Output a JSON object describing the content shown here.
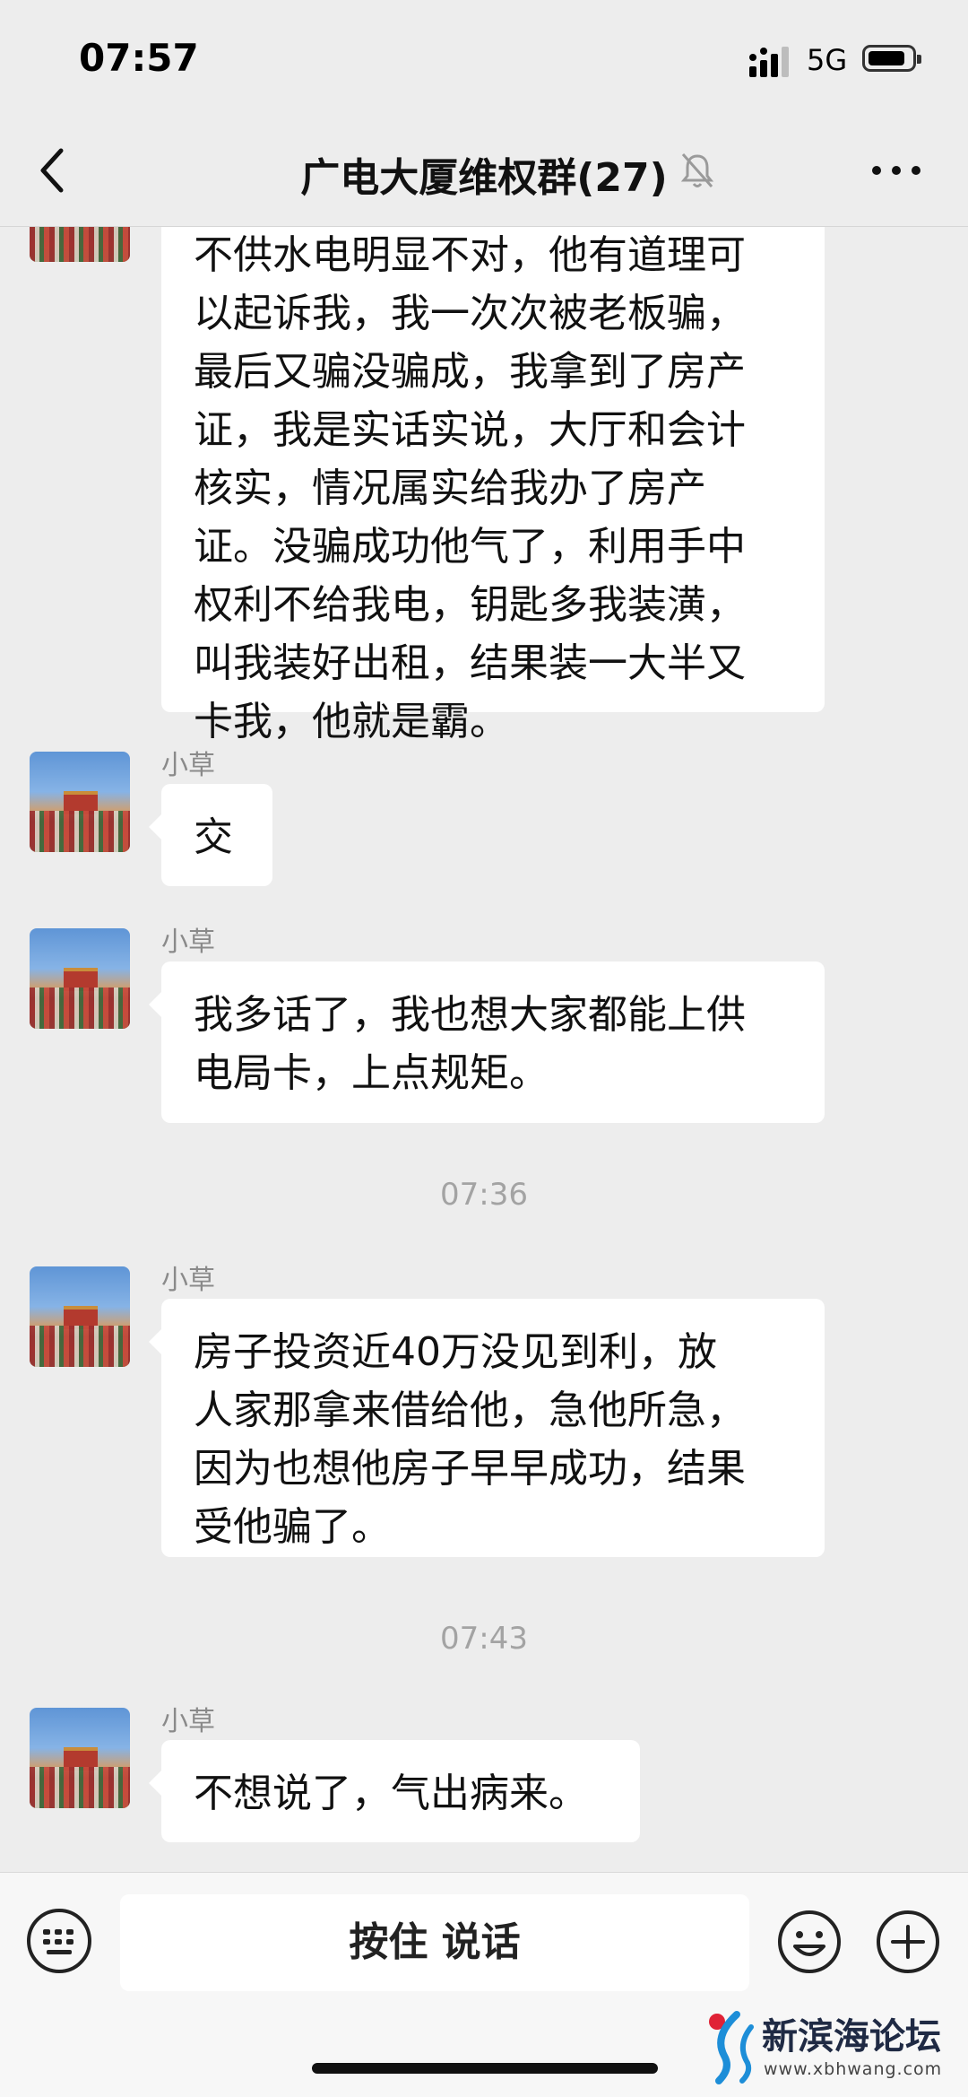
{
  "status": {
    "time": "07:57",
    "network": "5G"
  },
  "nav": {
    "title": "广电大厦维权群(27)"
  },
  "messages": [
    {
      "text": "不供水电明显不对，他有道理可\n以起诉我，我一次次被老板骗，\n最后又骗没骗成，我拿到了房产\n证，我是实话实说，大厅和会计\n核实，情况属实给我办了房产\n证。没骗成功他气了，利用手中\n权利不给我电，钥匙多我装潢，\n叫我装好出租，结果装一大半又\n卡我，他就是霸。"
    },
    {
      "sender": "小草",
      "text": "交"
    },
    {
      "sender": "小草",
      "text": "我多话了，我也想大家都能上供\n电局卡，上点规矩。"
    },
    {
      "sender": "小草",
      "text": "房子投资近40万没见到利，放\n人家那拿来借给他，急他所急，\n因为也想他房子早早成功，结果\n受他骗了。"
    },
    {
      "sender": "小草",
      "text": "不想说了，气出病来。"
    }
  ],
  "timestamps": [
    "07:36",
    "07:43"
  ],
  "input_bar": {
    "talk_label": "按住 说话"
  },
  "watermark": {
    "name": "新滨海论坛",
    "url": "www.xbhwang.com"
  },
  "icons": [
    "back-icon",
    "mute-icon",
    "more-icon",
    "keyboard-icon",
    "emoji-icon",
    "plus-icon"
  ]
}
